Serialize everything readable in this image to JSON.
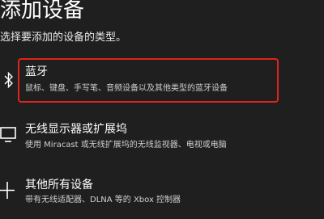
{
  "header": {
    "title": "添加设备",
    "subtitle": "选择要添加的设备的类型。"
  },
  "options": [
    {
      "title": "蓝牙",
      "description": "鼠标、键盘、手写笔、音频设备以及其他类型的蓝牙设备",
      "icon": "bluetooth-icon"
    },
    {
      "title": "无线显示器或扩展坞",
      "description": "使用 Miracast 或无线扩展坞的无线监视器、电视或电脑",
      "icon": "monitor-icon"
    },
    {
      "title": "其他所有设备",
      "description": "带有无线适配器、DLNA 等的 Xbox 控制器",
      "icon": "plus-icon"
    }
  ],
  "colors": {
    "background": "#1f1f1f",
    "text": "#ffffff",
    "highlight": "#e0241b"
  }
}
